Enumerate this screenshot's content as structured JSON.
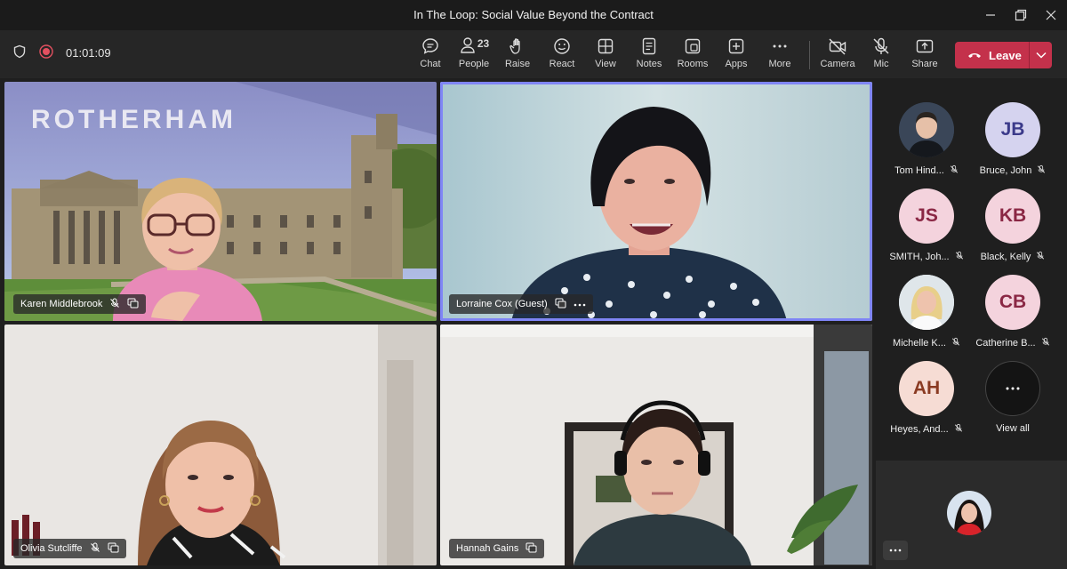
{
  "window": {
    "title": "In The Loop: Social Value Beyond the Contract"
  },
  "toolbar": {
    "timer": "01:01:09",
    "people_count": "23",
    "buttons": [
      {
        "label": "Chat",
        "icon": "chat-icon"
      },
      {
        "label": "People",
        "icon": "people-icon"
      },
      {
        "label": "Raise",
        "icon": "raise-hand-icon"
      },
      {
        "label": "React",
        "icon": "react-icon"
      },
      {
        "label": "View",
        "icon": "view-icon"
      },
      {
        "label": "Notes",
        "icon": "notes-icon"
      },
      {
        "label": "Rooms",
        "icon": "rooms-icon"
      },
      {
        "label": "Apps",
        "icon": "apps-icon"
      },
      {
        "label": "More",
        "icon": "more-icon"
      },
      {
        "label": "Camera",
        "icon": "camera-off-icon"
      },
      {
        "label": "Mic",
        "icon": "mic-off-icon"
      },
      {
        "label": "Share",
        "icon": "share-icon"
      }
    ],
    "leave_label": "Leave",
    "accent_red": "#c4314b"
  },
  "stage": {
    "tiles": [
      {
        "name": "Karen Middlebrook",
        "background_text": "ROTHERHAM"
      },
      {
        "name": "Lorraine Cox (Guest)",
        "active": true
      },
      {
        "name": "Olivia Sutcliffe"
      },
      {
        "name": "Hannah Gains"
      }
    ]
  },
  "sidebar": {
    "participants": [
      {
        "name": "Tom Hind...",
        "type": "photo"
      },
      {
        "name": "Bruce, John",
        "initials": "JB",
        "color": "#d5d3ef",
        "text_color": "#3b3a8a"
      },
      {
        "name": "SMITH, Joh...",
        "initials": "JS",
        "color": "#f4d3dd",
        "text_color": "#8a2744"
      },
      {
        "name": "Black, Kelly",
        "initials": "KB",
        "color": "#f4d3dd",
        "text_color": "#8a2744"
      },
      {
        "name": "Michelle K...",
        "type": "photo"
      },
      {
        "name": "Catherine B...",
        "initials": "CB",
        "color": "#f4d3dd",
        "text_color": "#8a2744"
      },
      {
        "name": "Heyes, And...",
        "initials": "AH",
        "color": "#f6dcd4",
        "text_color": "#8a3a22"
      }
    ],
    "view_all_label": "View all"
  }
}
